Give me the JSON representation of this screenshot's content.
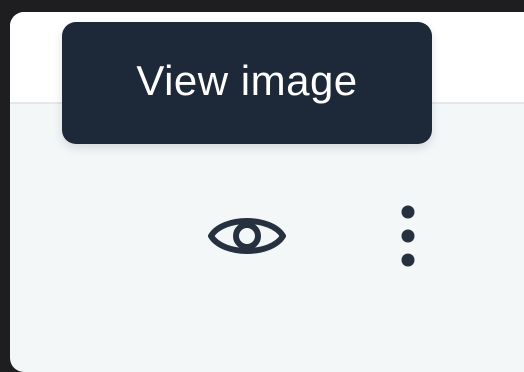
{
  "tooltip": {
    "text": "View image"
  },
  "actions": {
    "view_icon": "eye-icon",
    "more_icon": "vertical-dots-icon"
  },
  "colors": {
    "tooltip_bg": "#1d2838",
    "tooltip_text": "#ffffff",
    "icon": "#26313f",
    "panel_bg": "#f3f7f8",
    "page_bg": "#1e1e20"
  }
}
